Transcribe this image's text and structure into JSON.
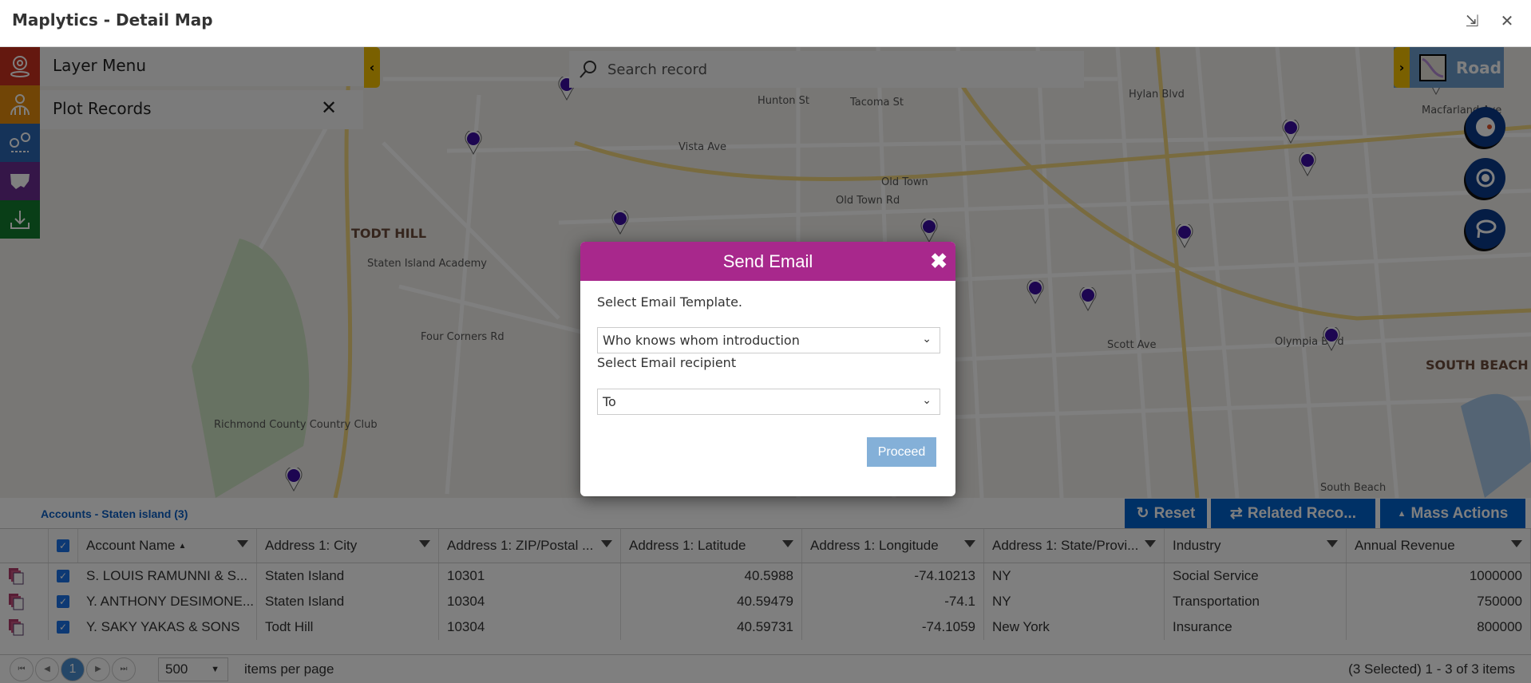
{
  "window": {
    "title": "Maplytics - Detail Map",
    "restore_icon": "restore-icon",
    "close_icon": "close-icon"
  },
  "left_toolbar": [
    {
      "icon": "location-pin-icon",
      "color": "#c8301e"
    },
    {
      "icon": "globe-pin-icon",
      "color": "#e28a0d"
    },
    {
      "icon": "route-pins-icon",
      "color": "#2b67b3"
    },
    {
      "icon": "us-map-icon",
      "color": "#6b2c91"
    },
    {
      "icon": "download-icon",
      "color": "#137c2f"
    }
  ],
  "layer_menu": {
    "title": "Layer Menu",
    "collapse_color": "#f5c000"
  },
  "plot_records": {
    "title": "Plot Records"
  },
  "search": {
    "placeholder": "Search record"
  },
  "map_type": {
    "label": "Road"
  },
  "map": {
    "labels": [
      {
        "text": "TODT HILL",
        "big": true
      },
      {
        "text": "SOUTH BEACH",
        "big": true
      },
      {
        "text": "Old Town"
      },
      {
        "text": "Vista Ave"
      },
      {
        "text": "Old Town Rd"
      },
      {
        "text": "Hylan Blvd"
      },
      {
        "text": "Olympia Blvd"
      },
      {
        "text": "Four Corners Rd"
      },
      {
        "text": "Staten Island Academy"
      },
      {
        "text": "Richmond County Country Club"
      },
      {
        "text": "Macfarland Ave"
      },
      {
        "text": "South Beach"
      },
      {
        "text": "Scott Ave"
      },
      {
        "text": "Hunton St"
      },
      {
        "text": "Tacoma St"
      }
    ],
    "pin_color": "#3a0ca3"
  },
  "grid": {
    "title": "Accounts - Staten island (3)",
    "buttons": {
      "reset": "Reset",
      "related": "Related Reco...",
      "mass": "Mass Actions"
    },
    "columns": [
      "Account Name",
      "Address 1: City",
      "Address 1: ZIP/Postal ...",
      "Address 1: Latitude",
      "Address 1: Longitude",
      "Address 1: State/Provi...",
      "Industry",
      "Annual Revenue"
    ],
    "sort_indicator": "▲",
    "rows": [
      [
        "S. LOUIS RAMUNNI & S...",
        "Staten Island",
        "10301",
        "40.5988",
        "-74.10213",
        "NY",
        "Social Service",
        "1000000"
      ],
      [
        "Y. ANTHONY DESIMONE...",
        "Staten Island",
        "10304",
        "40.59479",
        "-74.1",
        "NY",
        "Transportation",
        "750000"
      ],
      [
        "Y. SAKY YAKAS & SONS",
        "Todt Hill",
        "10304",
        "40.59731",
        "-74.1059",
        "New York",
        "Insurance",
        "800000"
      ]
    ],
    "all_selected": true
  },
  "pager": {
    "current_page": "1",
    "page_size": "500",
    "items_per_page": "items per page",
    "summary": "(3 Selected) 1 - 3 of 3 items"
  },
  "modal": {
    "title": "Send Email",
    "template_label": "Select Email Template.",
    "template_value": "Who knows whom introduction",
    "recipient_label": "Select Email recipient",
    "recipient_value": "To",
    "proceed": "Proceed",
    "header_color": "#a8288c"
  }
}
